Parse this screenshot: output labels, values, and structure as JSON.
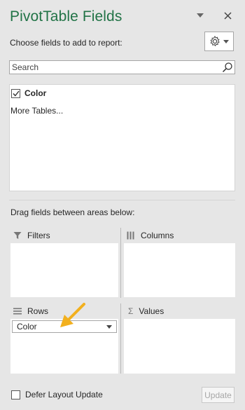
{
  "pane": {
    "title": "PivotTable Fields",
    "choose_label": "Choose fields to add to report:",
    "dropdown_icon": "chevron-down-icon",
    "close_icon": "close-icon",
    "settings_icon": "gear-icon"
  },
  "search": {
    "placeholder": "Search",
    "value": ""
  },
  "fields": [
    {
      "name": "Color",
      "checked": true
    }
  ],
  "more_tables": "More Tables...",
  "drag_label": "Drag fields between areas below:",
  "areas": {
    "filters": {
      "label": "Filters"
    },
    "columns": {
      "label": "Columns"
    },
    "rows": {
      "label": "Rows",
      "items": [
        "Color"
      ]
    },
    "values": {
      "label": "Values",
      "symbol": "Σ"
    }
  },
  "footer": {
    "defer_label": "Defer Layout Update",
    "defer_checked": false,
    "update_label": "Update"
  },
  "colors": {
    "title": "#217346",
    "annotation_arrow": "#f2b01e",
    "pane_bg": "#e6e6e6"
  }
}
